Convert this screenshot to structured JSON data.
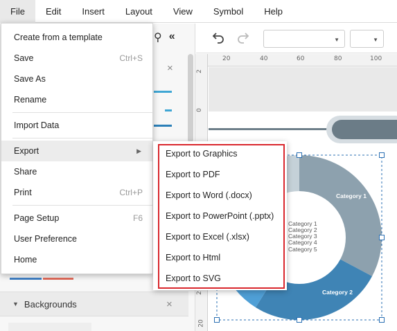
{
  "menubar": {
    "items": [
      "File",
      "Edit",
      "Insert",
      "Layout",
      "View",
      "Symbol",
      "Help"
    ],
    "active": "File"
  },
  "file_menu": {
    "items": [
      {
        "label": "Create from a template",
        "shortcut": ""
      },
      {
        "label": "Save",
        "shortcut": "Ctrl+S"
      },
      {
        "label": "Save As",
        "shortcut": ""
      },
      {
        "label": "Rename",
        "shortcut": ""
      },
      {
        "label": "Import Data",
        "shortcut": ""
      },
      {
        "label": "Export",
        "shortcut": ""
      },
      {
        "label": "Share",
        "shortcut": ""
      },
      {
        "label": "Print",
        "shortcut": "Ctrl+P"
      },
      {
        "label": "Page Setup",
        "shortcut": "F6"
      },
      {
        "label": "User Preference",
        "shortcut": ""
      },
      {
        "label": "Home",
        "shortcut": ""
      }
    ]
  },
  "export_menu": {
    "items": [
      "Export to Graphics",
      "Export to PDF",
      "Export to Word (.docx)",
      "Export to PowerPoint (.pptx)",
      "Export to Excel (.xlsx)",
      "Export to Html",
      "Export to SVG"
    ],
    "highlight_color": "#d9262c"
  },
  "left_panel": {
    "backgrounds_title": "Backgrounds",
    "close_glyph": "×"
  },
  "toolbar": {
    "undo_icon": "undo-icon",
    "redo_icon": "redo-icon",
    "search_glyph": "⚲",
    "collapse_glyph": "«"
  },
  "ruler": {
    "top_labels": [
      "20",
      "40",
      "60",
      "80",
      "100"
    ],
    "left_labels": [
      "2",
      "0",
      "2",
      "20"
    ]
  },
  "chart": {
    "legend": [
      "Category 1",
      "Category 2",
      "Category 3",
      "Category 4",
      "Category 5"
    ],
    "slice_labels": [
      "Category 1",
      "Category 2"
    ],
    "colors": [
      "#8da1ae",
      "#3f84b5",
      "#4f9fd6",
      "#9fb3c0",
      "#c5d1d8"
    ]
  }
}
